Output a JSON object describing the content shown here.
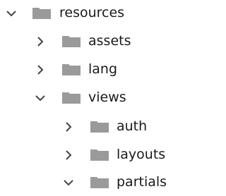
{
  "tree": {
    "folder_color": "#9a9a9a",
    "chevron_color": "#444444",
    "nodes": [
      {
        "label": "resources",
        "expanded": true,
        "level": 0,
        "icon": "folder-icon"
      },
      {
        "label": "assets",
        "expanded": false,
        "level": 1,
        "icon": "folder-icon"
      },
      {
        "label": "lang",
        "expanded": false,
        "level": 1,
        "icon": "folder-icon"
      },
      {
        "label": "views",
        "expanded": true,
        "level": 1,
        "icon": "folder-icon"
      },
      {
        "label": "auth",
        "expanded": false,
        "level": 2,
        "icon": "folder-icon"
      },
      {
        "label": "layouts",
        "expanded": false,
        "level": 2,
        "icon": "folder-icon"
      },
      {
        "label": "partials",
        "expanded": true,
        "level": 2,
        "icon": "folder-icon"
      }
    ]
  }
}
